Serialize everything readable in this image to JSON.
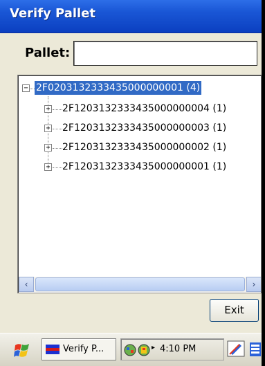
{
  "window": {
    "title": "Verify Pallet"
  },
  "pallet": {
    "label": "Pallet:",
    "value": ""
  },
  "tree": {
    "root": {
      "label": "2F0203132333435000000001 (4)",
      "expander": "−"
    },
    "children": [
      {
        "label": "2F1203132333435000000004 (1)",
        "expander": "+"
      },
      {
        "label": "2F1203132333435000000003 (1)",
        "expander": "+"
      },
      {
        "label": "2F1203132333435000000002 (1)",
        "expander": "+"
      },
      {
        "label": "2F1203132333435000000001 (1)",
        "expander": "+"
      }
    ],
    "scroll_left": "‹",
    "scroll_right": "›"
  },
  "buttons": {
    "exit": "Exit"
  },
  "taskbar": {
    "task_label": "Verify P...",
    "tray_arrow": "▸",
    "clock": "4:10 PM",
    "icons": [
      "windows-start-icon",
      "network-icon",
      "sync-icon",
      "edit-pen-icon",
      "keyboard-icon"
    ]
  },
  "colors": {
    "titlebar": "#1a57d6",
    "selection": "#316ac5",
    "window_bg": "#ece9d8"
  }
}
